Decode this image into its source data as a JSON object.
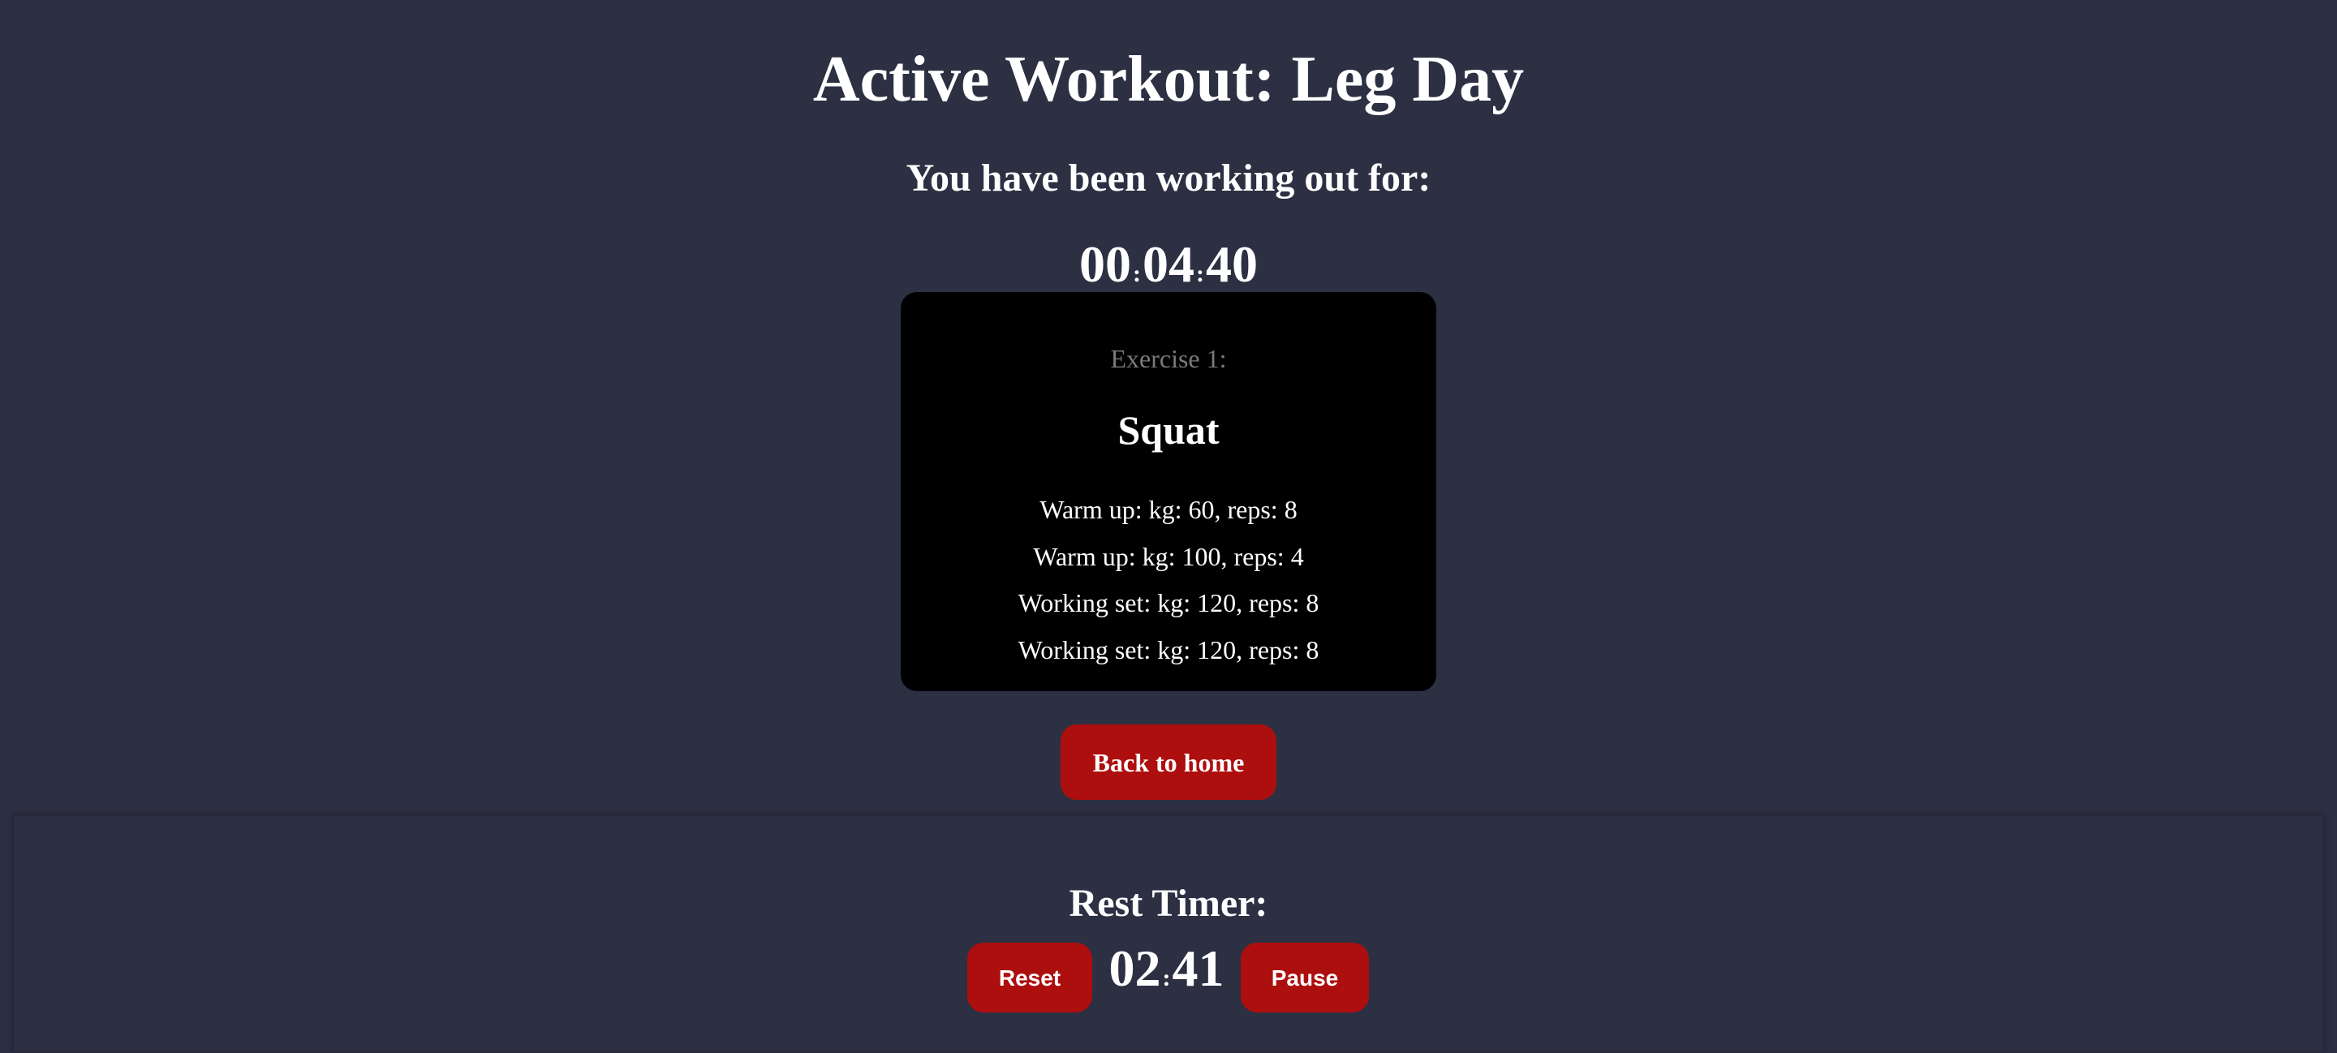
{
  "header": {
    "title": "Active Workout: Leg Day",
    "subtitle": "You have been working out for:"
  },
  "workout_timer": {
    "hours": "00",
    "minutes": "04",
    "seconds": "40",
    "separator": ":"
  },
  "exercise": {
    "label": "Exercise 1:",
    "name": "Squat",
    "sets": [
      "Warm up: kg: 60, reps: 8",
      "Warm up: kg: 100, reps: 4",
      "Working set: kg: 120, reps: 8",
      "Working set: kg: 120, reps: 8"
    ]
  },
  "actions": {
    "back_label": "Back to home"
  },
  "rest_timer": {
    "title": "Rest Timer:",
    "minutes": "02",
    "seconds": "41",
    "separator": ":",
    "reset_label": "Reset",
    "pause_label": "Pause"
  },
  "colors": {
    "background": "#2d3043",
    "card": "#000000",
    "accent": "#ad0e0e",
    "muted_text": "#7a7a7a"
  }
}
